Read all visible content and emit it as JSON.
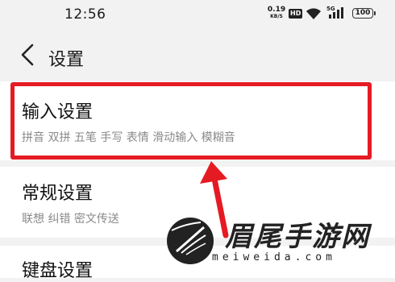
{
  "status_bar": {
    "time": "12:56",
    "net_speed_value": "0.19",
    "net_speed_unit": "KB/S",
    "hd_badge": "HD",
    "network_type": "5G",
    "battery": "100"
  },
  "header": {
    "title": "设置"
  },
  "settings": {
    "items": [
      {
        "title": "输入设置",
        "description": "拼音 双拼 五笔 手写 表情 滑动输入 模糊音"
      },
      {
        "title": "常规设置",
        "description": "联想 纠错 密文传送"
      },
      {
        "title": "键盘设置"
      }
    ]
  },
  "watermark": {
    "brand_text": "眉尾手游网",
    "url_text": "meiweida.com"
  },
  "colors": {
    "highlight": "#e51b24",
    "background": "#f2f2f2"
  }
}
